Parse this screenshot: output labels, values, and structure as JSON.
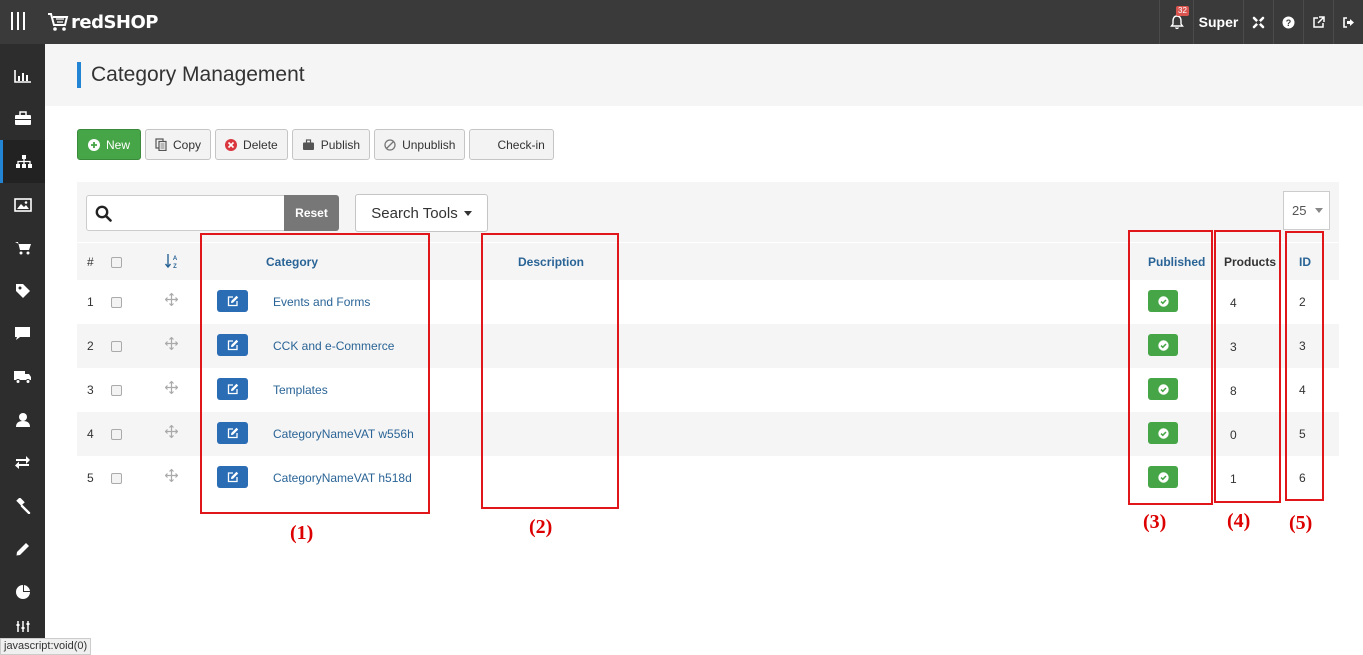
{
  "app": {
    "brand": "redSHOP",
    "notification_count": "32",
    "user": "Super"
  },
  "page": {
    "title": "Category Management"
  },
  "toolbar": {
    "new_label": "New",
    "copy_label": "Copy",
    "delete_label": "Delete",
    "publish_label": "Publish",
    "unpublish_label": "Unpublish",
    "checkin_label": "Check-in"
  },
  "filters": {
    "reset_label": "Reset",
    "search_tools_label": "Search Tools",
    "search_value": "",
    "limit": "25"
  },
  "table": {
    "headers": {
      "num": "#",
      "category": "Category",
      "description": "Description",
      "published": "Published",
      "products": "Products",
      "id": "ID"
    },
    "rows": [
      {
        "num": "1",
        "category": "Events and Forms",
        "description": "",
        "products": "4",
        "id": "2"
      },
      {
        "num": "2",
        "category": "CCK and e-Commerce",
        "description": "",
        "products": "3",
        "id": "3"
      },
      {
        "num": "3",
        "category": "Templates",
        "description": "",
        "products": "8",
        "id": "4"
      },
      {
        "num": "4",
        "category": "CategoryNameVAT w556h",
        "description": "",
        "products": "0",
        "id": "5"
      },
      {
        "num": "5",
        "category": "CategoryNameVAT h518d",
        "description": "",
        "products": "1",
        "id": "6"
      }
    ]
  },
  "annotations": [
    "(1)",
    "(2)",
    "(3)",
    "(4)",
    "(5)"
  ],
  "status_bar": "javascript:void(0)",
  "colors": {
    "accent": "#2384d3",
    "success": "#46a546",
    "danger": "#e0161b",
    "topbar": "#3a3a3a",
    "sidebar": "#2d2d2d"
  }
}
